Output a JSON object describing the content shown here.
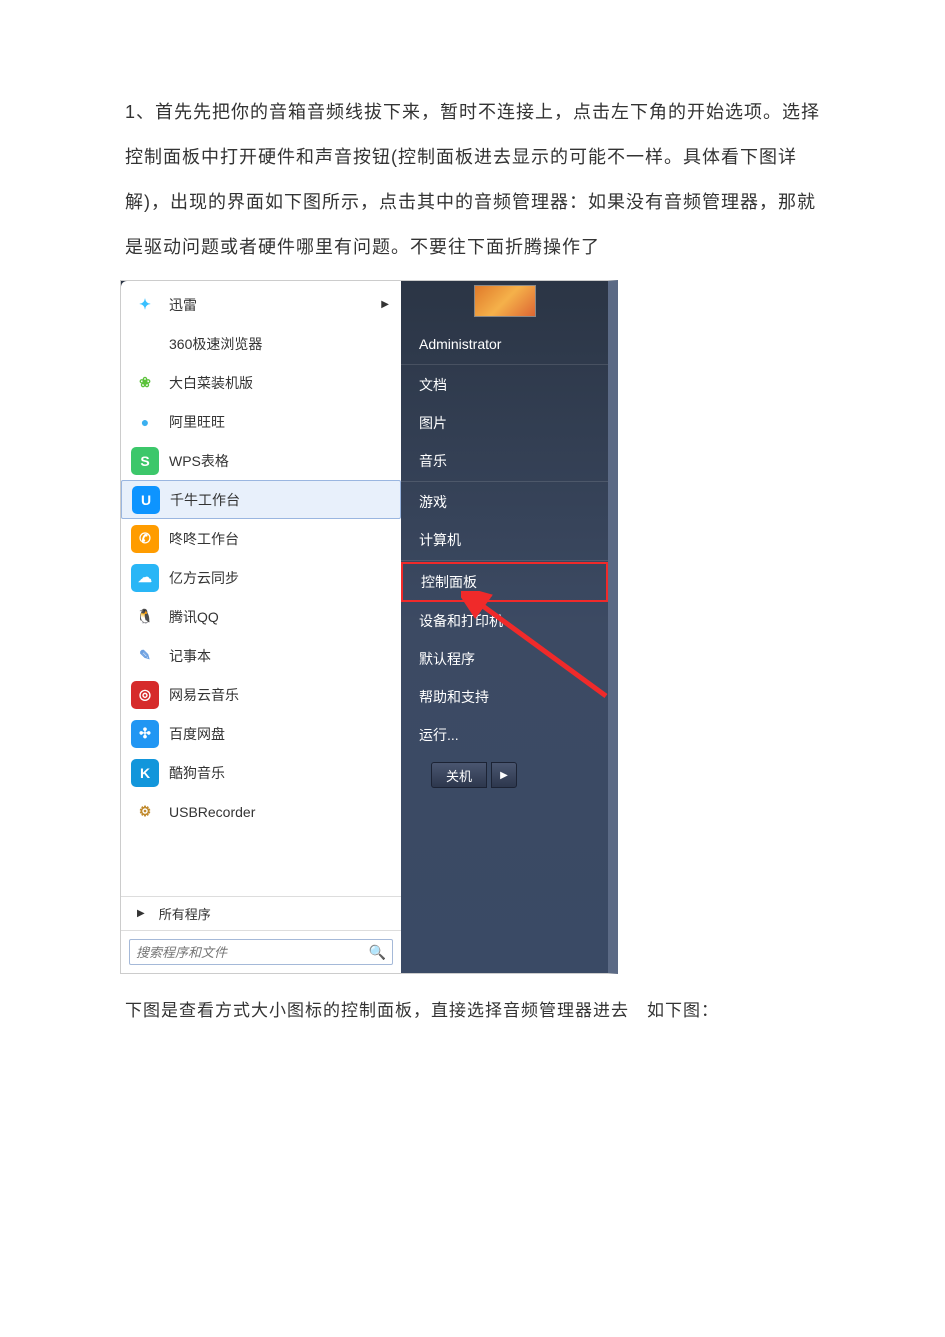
{
  "para1": "1、首先先把你的音箱音频线拔下来，暂时不连接上，点击左下角的开始选项。选择控制面板中打开硬件和声音按钮(控制面板进去显示的可能不一样。具体看下图详解)，出现的界面如下图所示，点击其中的音频管理器：如果没有音频管理器，那就是驱动问题或者硬件哪里有问题。不要往下面折腾操作了",
  "caption": "下图是查看方式大小图标的控制面板，直接选择音频管理器进去　如下图：",
  "apps": [
    {
      "label": "迅雷",
      "hasArrow": true,
      "iconClass": "ic-xl",
      "glyph": "✦"
    },
    {
      "label": "360极速浏览器",
      "iconClass": "ic-360",
      "glyph": "✿"
    },
    {
      "label": "大白菜装机版",
      "iconClass": "ic-dbc",
      "glyph": "❀"
    },
    {
      "label": "阿里旺旺",
      "iconClass": "ic-ali",
      "glyph": "●"
    },
    {
      "label": "WPS表格",
      "iconClass": "ic-wps",
      "glyph": "S"
    },
    {
      "label": "千牛工作台",
      "iconClass": "ic-qn",
      "glyph": "U",
      "selected": true
    },
    {
      "label": "咚咚工作台",
      "iconClass": "ic-dd",
      "glyph": "✆"
    },
    {
      "label": "亿方云同步",
      "iconClass": "ic-yf",
      "glyph": "☁"
    },
    {
      "label": "腾讯QQ",
      "iconClass": "ic-qq",
      "glyph": "🐧"
    },
    {
      "label": "记事本",
      "iconClass": "ic-note",
      "glyph": "✎"
    },
    {
      "label": "网易云音乐",
      "iconClass": "ic-wy",
      "glyph": "◎"
    },
    {
      "label": "百度网盘",
      "iconClass": "ic-bd",
      "glyph": "✣"
    },
    {
      "label": "酷狗音乐",
      "iconClass": "ic-kg",
      "glyph": "K"
    },
    {
      "label": "USBRecorder",
      "iconClass": "ic-usb",
      "glyph": "⚙"
    }
  ],
  "allPrograms": "所有程序",
  "search": {
    "placeholder": "搜索程序和文件"
  },
  "rightTop": "Administrator",
  "rightItems1": [
    "文档",
    "图片",
    "音乐"
  ],
  "rightItems2": [
    "游戏",
    "计算机"
  ],
  "controlPanel": "控制面板",
  "rightItems3": [
    "设备和打印机",
    "默认程序",
    "帮助和支持",
    "运行..."
  ],
  "shutdown": "关机"
}
